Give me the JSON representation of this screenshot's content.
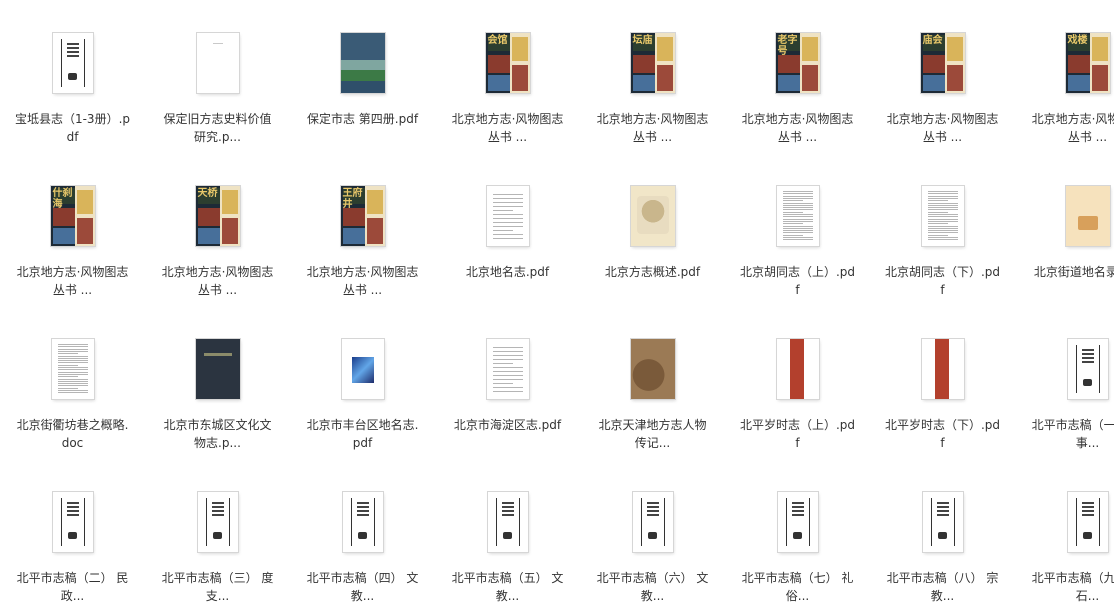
{
  "files": [
    {
      "label": "宝坻县志（1-3册）.pdf",
      "thumb": "scan-title-page-icon"
    },
    {
      "label": "保定旧方志史料价值研究.p...",
      "thumb": "blank-page-icon"
    },
    {
      "label": "保定市志 第四册.pdf",
      "thumb": "book-cover-landscape-icon"
    },
    {
      "label": "北京地方志·风物图志丛书 ...",
      "thumb": "book-cover-collage-icon",
      "title": "会馆"
    },
    {
      "label": "北京地方志·风物图志丛书 ...",
      "thumb": "book-cover-collage-icon",
      "title": "坛庙"
    },
    {
      "label": "北京地方志·风物图志丛书 ...",
      "thumb": "book-cover-collage-icon",
      "title": "老字号"
    },
    {
      "label": "北京地方志·风物图志丛书 ...",
      "thumb": "book-cover-collage-icon",
      "title": "庙会"
    },
    {
      "label": "北京地方志·风物图志丛书 ...",
      "thumb": "book-cover-collage-icon",
      "title": "戏楼"
    },
    {
      "label": "北京地方志·风物图志丛书 ...",
      "thumb": "book-cover-collage-icon",
      "title": "什刹海"
    },
    {
      "label": "北京地方志·风物图志丛书 ...",
      "thumb": "book-cover-collage-icon",
      "title": "天桥"
    },
    {
      "label": "北京地方志·风物图志丛书 ...",
      "thumb": "book-cover-collage-icon",
      "title": "王府井"
    },
    {
      "label": "北京地名志.pdf",
      "thumb": "text-page-icon"
    },
    {
      "label": "北京方志概述.pdf",
      "thumb": "illustrated-cover-icon"
    },
    {
      "label": "北京胡同志（上）.pdf",
      "thumb": "dense-text-page-icon"
    },
    {
      "label": "北京胡同志（下）.pdf",
      "thumb": "dense-text-page-icon"
    },
    {
      "label": "北京街道地名录.pdf",
      "thumb": "orange-cover-icon"
    },
    {
      "label": "北京街衢坊巷之概略.doc",
      "thumb": "dense-text-page-icon"
    },
    {
      "label": "北京市东城区文化文物志.p...",
      "thumb": "dark-cover-icon"
    },
    {
      "label": "北京市丰台区地名志.pdf",
      "thumb": "blue-cover-icon"
    },
    {
      "label": "北京市海淀区志.pdf",
      "thumb": "text-page-icon"
    },
    {
      "label": "北京天津地方志人物传记...",
      "thumb": "old-map-cover-icon"
    },
    {
      "label": "北平岁时志（上）.pdf",
      "thumb": "red-spine-icon"
    },
    {
      "label": "北平岁时志（下）.pdf",
      "thumb": "red-spine-icon"
    },
    {
      "label": "北平市志稿（一） 前事...",
      "thumb": "scan-title-page-icon"
    },
    {
      "label": "北平市志稿（二） 民政...",
      "thumb": "scan-title-page-icon"
    },
    {
      "label": "北平市志稿（三） 度支...",
      "thumb": "scan-title-page-icon"
    },
    {
      "label": "北平市志稿（四） 文教...",
      "thumb": "scan-title-page-icon"
    },
    {
      "label": "北平市志稿（五） 文教...",
      "thumb": "scan-title-page-icon"
    },
    {
      "label": "北平市志稿（六） 文教...",
      "thumb": "scan-title-page-icon"
    },
    {
      "label": "北平市志稿（七） 礼俗...",
      "thumb": "scan-title-page-icon"
    },
    {
      "label": "北平市志稿（八） 宗教...",
      "thumb": "scan-title-page-icon"
    },
    {
      "label": "北平市志稿（九） 金石...",
      "thumb": "scan-title-page-icon"
    }
  ]
}
